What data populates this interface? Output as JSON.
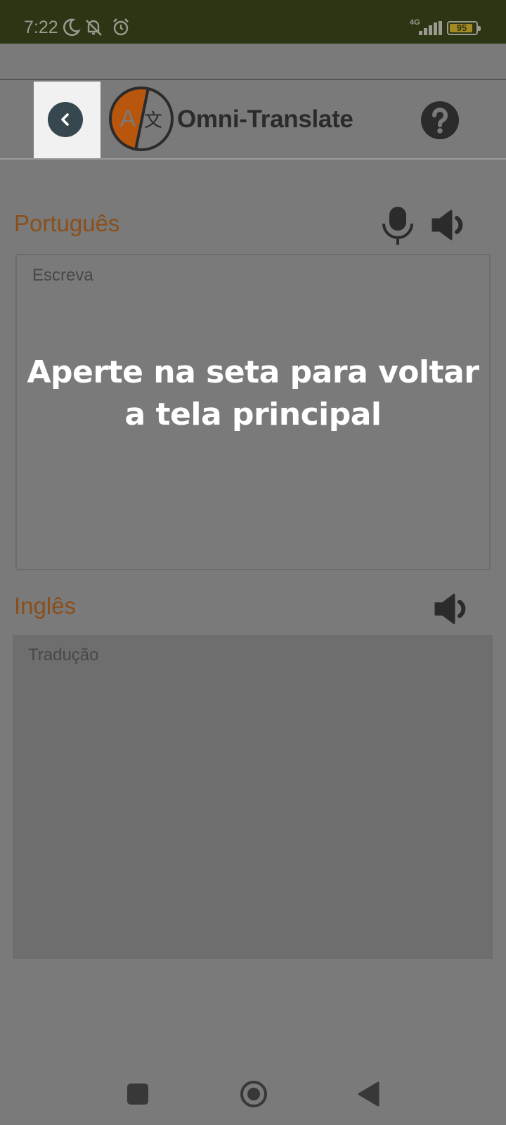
{
  "status_bar": {
    "time": "7:22",
    "network": "4G",
    "battery": "95",
    "icons": [
      "moon-icon",
      "mute-bell-icon",
      "alarm-icon",
      "signal-icon",
      "battery-icon"
    ]
  },
  "app_bar": {
    "title": "Omni-Translate",
    "icons": [
      "back-arrow-icon",
      "translate-logo-icon",
      "help-icon"
    ]
  },
  "source": {
    "language": "Português",
    "placeholder": "Escreva",
    "icons": [
      "microphone-icon",
      "speaker-icon"
    ]
  },
  "target": {
    "language": "Inglês",
    "placeholder": "Tradução",
    "icons": [
      "speaker-icon"
    ]
  },
  "tutorial": {
    "message": "Aperte na seta para voltar a tela principal"
  },
  "nav_bar": {
    "icons": [
      "recents-square-icon",
      "home-circle-icon",
      "back-triangle-icon"
    ]
  },
  "colors": {
    "status_bar": "#2d3614",
    "language_label": "#8a4f1b",
    "logo_orange": "#b8560d",
    "overlay": "#7a7a7a",
    "back_button": "#37474f",
    "highlight": "#f1f1f1"
  }
}
